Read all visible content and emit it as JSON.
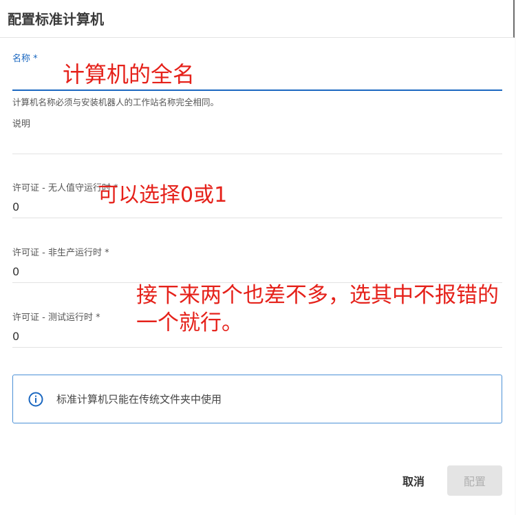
{
  "dialog": {
    "title": "配置标准计算机",
    "cancel_label": "取消",
    "confirm_label": "配置"
  },
  "fields": {
    "name": {
      "label": "名称 *",
      "value": "",
      "hint": "计算机名称必须与安装机器人的工作站名称完全相同。"
    },
    "description": {
      "label": "说明",
      "value": ""
    },
    "license_unattended": {
      "label": "许可证 - 无人值守运行时 *",
      "value": "0"
    },
    "license_nonproduction": {
      "label": "许可证 - 非生产运行时 *",
      "value": "0"
    },
    "license_testing": {
      "label": "许可证 - 测试运行时 *",
      "value": "0"
    }
  },
  "info": {
    "icon": "info-circle-icon",
    "text": "标准计算机只能在传统文件夹中使用"
  },
  "annotations": {
    "name_note": "计算机的全名",
    "license_note": "可以选择0或1",
    "other_note": "接下来两个也差不多，选其中不报错的一个就行。"
  },
  "colors": {
    "accent": "#1a67c0",
    "annotation": "#e5211a",
    "info_border": "#4a8fd6",
    "disabled_button": "#e4e4e4"
  }
}
